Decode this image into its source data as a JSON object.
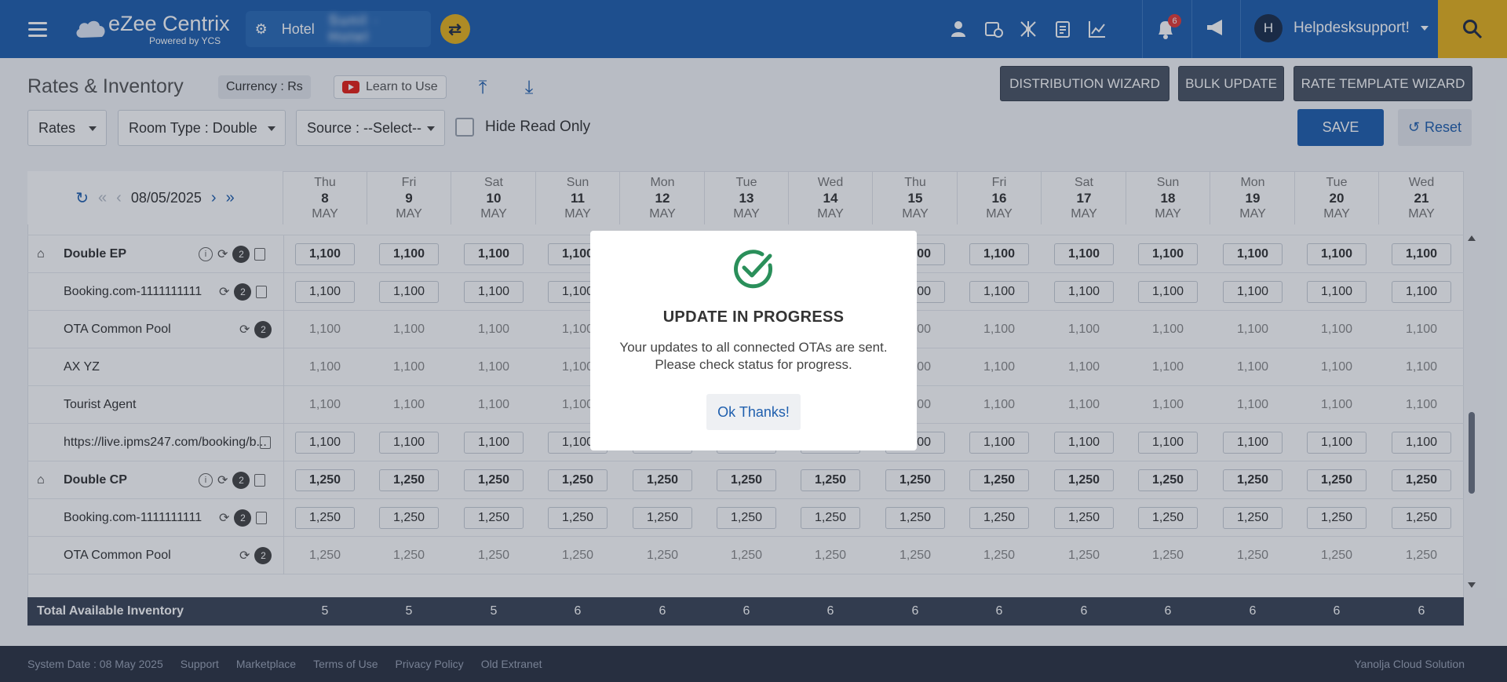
{
  "header": {
    "app_name": "eZee Centrix",
    "app_sub": "Powered by YCS",
    "hotel_label": "Hotel",
    "hotel_name": "Sunil ·  Hotel",
    "notification_count": "6",
    "user_initial": "H",
    "user_name": "Helpdesksupport!"
  },
  "toolbar": {
    "title": "Rates & Inventory",
    "currency": "Currency : Rs",
    "learn": "Learn to Use",
    "distribution_wizard": "DISTRIBUTION WIZARD",
    "bulk_update": "BULK UPDATE",
    "rate_template_wizard": "RATE TEMPLATE WIZARD",
    "rates_select": "Rates",
    "room_type": "Room Type :  Double",
    "source": "Source :  --Select--",
    "hide_read_only": "Hide Read Only",
    "save": "SAVE",
    "reset": "Reset"
  },
  "grid": {
    "current_date": "08/05/2025",
    "days": [
      {
        "dow": "Thu",
        "date": "8",
        "mon": "MAY"
      },
      {
        "dow": "Fri",
        "date": "9",
        "mon": "MAY"
      },
      {
        "dow": "Sat",
        "date": "10",
        "mon": "MAY"
      },
      {
        "dow": "Sun",
        "date": "11",
        "mon": "MAY"
      },
      {
        "dow": "Mon",
        "date": "12",
        "mon": "MAY"
      },
      {
        "dow": "Tue",
        "date": "13",
        "mon": "MAY"
      },
      {
        "dow": "Wed",
        "date": "14",
        "mon": "MAY"
      },
      {
        "dow": "Thu",
        "date": "15",
        "mon": "MAY"
      },
      {
        "dow": "Fri",
        "date": "16",
        "mon": "MAY"
      },
      {
        "dow": "Sat",
        "date": "17",
        "mon": "MAY"
      },
      {
        "dow": "Sun",
        "date": "18",
        "mon": "MAY"
      },
      {
        "dow": "Mon",
        "date": "19",
        "mon": "MAY"
      },
      {
        "dow": "Tue",
        "date": "20",
        "mon": "MAY"
      },
      {
        "dow": "Wed",
        "date": "21",
        "mon": "MAY"
      }
    ],
    "rows": [
      {
        "label": "Double EP",
        "bold": true,
        "editable": true,
        "value": "1,100",
        "icons": "info-sync-badge-copy"
      },
      {
        "label": "Booking.com-1111111111",
        "bold": false,
        "editable": true,
        "value": "1,100",
        "icons": "sync-badge-copy"
      },
      {
        "label": "OTA Common Pool",
        "bold": false,
        "editable": false,
        "value": "1,100",
        "icons": "sync-badge"
      },
      {
        "label": "AX YZ",
        "bold": false,
        "editable": false,
        "value": "1,100",
        "icons": ""
      },
      {
        "label": "Tourist Agent",
        "bold": false,
        "editable": false,
        "value": "1,100",
        "icons": ""
      },
      {
        "label": "https://live.ipms247.com/booking/b...",
        "bold": false,
        "editable": true,
        "value": "1,100",
        "icons": "copy"
      },
      {
        "label": "Double CP",
        "bold": true,
        "editable": true,
        "value": "1,250",
        "icons": "info-sync-badge-copy"
      },
      {
        "label": "Booking.com-1111111111",
        "bold": false,
        "editable": true,
        "value": "1,250",
        "icons": "sync-badge-copy"
      },
      {
        "label": "OTA Common Pool",
        "bold": false,
        "editable": false,
        "value": "1,250",
        "icons": "sync-badge"
      }
    ],
    "badge": "2",
    "total_label": "Total Available Inventory",
    "totals": [
      "5",
      "5",
      "5",
      "6",
      "6",
      "6",
      "6",
      "6",
      "6",
      "6",
      "6",
      "6",
      "6",
      "6"
    ]
  },
  "footer": {
    "system_date": "System Date : 08 May 2025",
    "support": "Support",
    "marketplace": "Marketplace",
    "terms": "Terms of Use",
    "privacy": "Privacy Policy",
    "old_extranet": "Old Extranet",
    "company": "Yanolja Cloud Solution"
  },
  "modal": {
    "title": "UPDATE IN PROGRESS",
    "line1": "Your updates to all connected OTAs are sent.",
    "line2": "Please check status for progress.",
    "ok": "Ok Thanks!"
  }
}
